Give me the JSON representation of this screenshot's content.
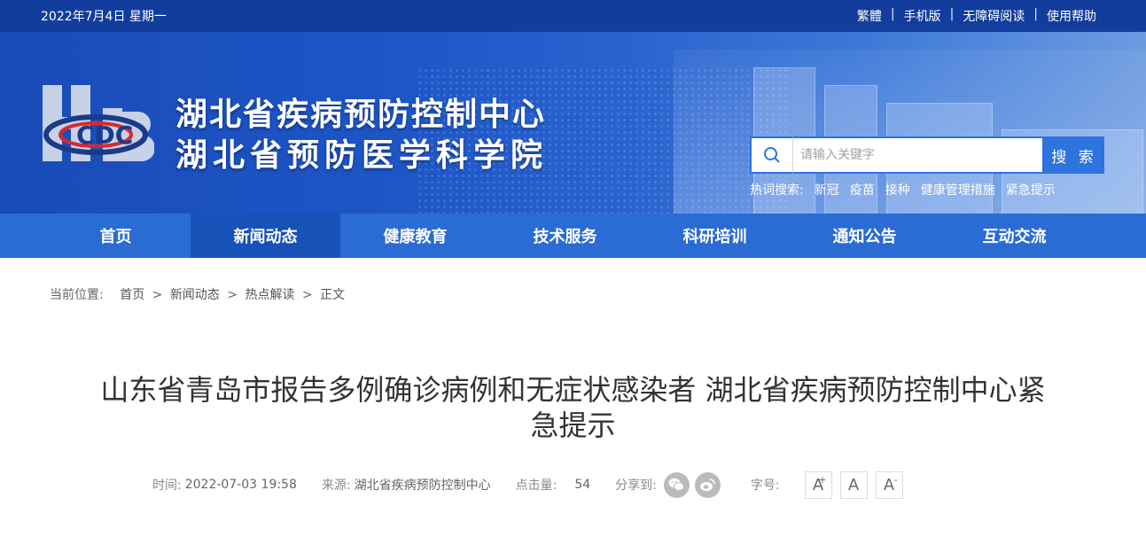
{
  "topbar": {
    "date": "2022年7月4日 星期一",
    "links": [
      "繁體",
      "手机版",
      "无障碍阅读",
      "使用帮助"
    ],
    "separator": "|"
  },
  "header": {
    "title_line1": "湖北省疾病预防控制中心",
    "title_line2": "湖北省预防医学科学院",
    "logo_icon": "hbcdc-logo-icon"
  },
  "search": {
    "placeholder": "请输入关键字",
    "button_label": "搜 索",
    "icon": "search-icon"
  },
  "hot": {
    "label": "热词搜索:",
    "keywords": [
      "新冠",
      "疫苗",
      "接种",
      "健康管理措施",
      "紧急提示"
    ]
  },
  "nav": {
    "items": [
      "首页",
      "新闻动态",
      "健康教育",
      "技术服务",
      "科研培训",
      "通知公告",
      "互动交流"
    ],
    "active": "新闻动态"
  },
  "breadcrumb": {
    "label": "当前位置:",
    "items": [
      "首页",
      "新闻动态",
      "热点解读",
      "正文"
    ],
    "separator": ">"
  },
  "article": {
    "title_line1": "山东省青岛市报告多例确诊病例和无症状感染者 湖北省疾病预防控制中心紧",
    "title_line2": "急提示",
    "time_label": "时间:",
    "time_value": "2022-07-03 19:58",
    "source_label": "来源:",
    "source_value": "湖北省疾病预防控制中心",
    "clicks_label": "点击量:",
    "clicks_value": "54",
    "share_label": "分享到:",
    "share_icons": [
      "wechat-icon",
      "weibo-icon"
    ],
    "font_label": "字号:",
    "font_buttons": [
      "A",
      "A",
      "A"
    ],
    "font_marks": [
      "+",
      "",
      "-"
    ]
  },
  "colors": {
    "topbar": "#123d9c",
    "nav": "#2a6bd4",
    "nav_active": "#1652b8",
    "search_button": "#2d74de"
  }
}
